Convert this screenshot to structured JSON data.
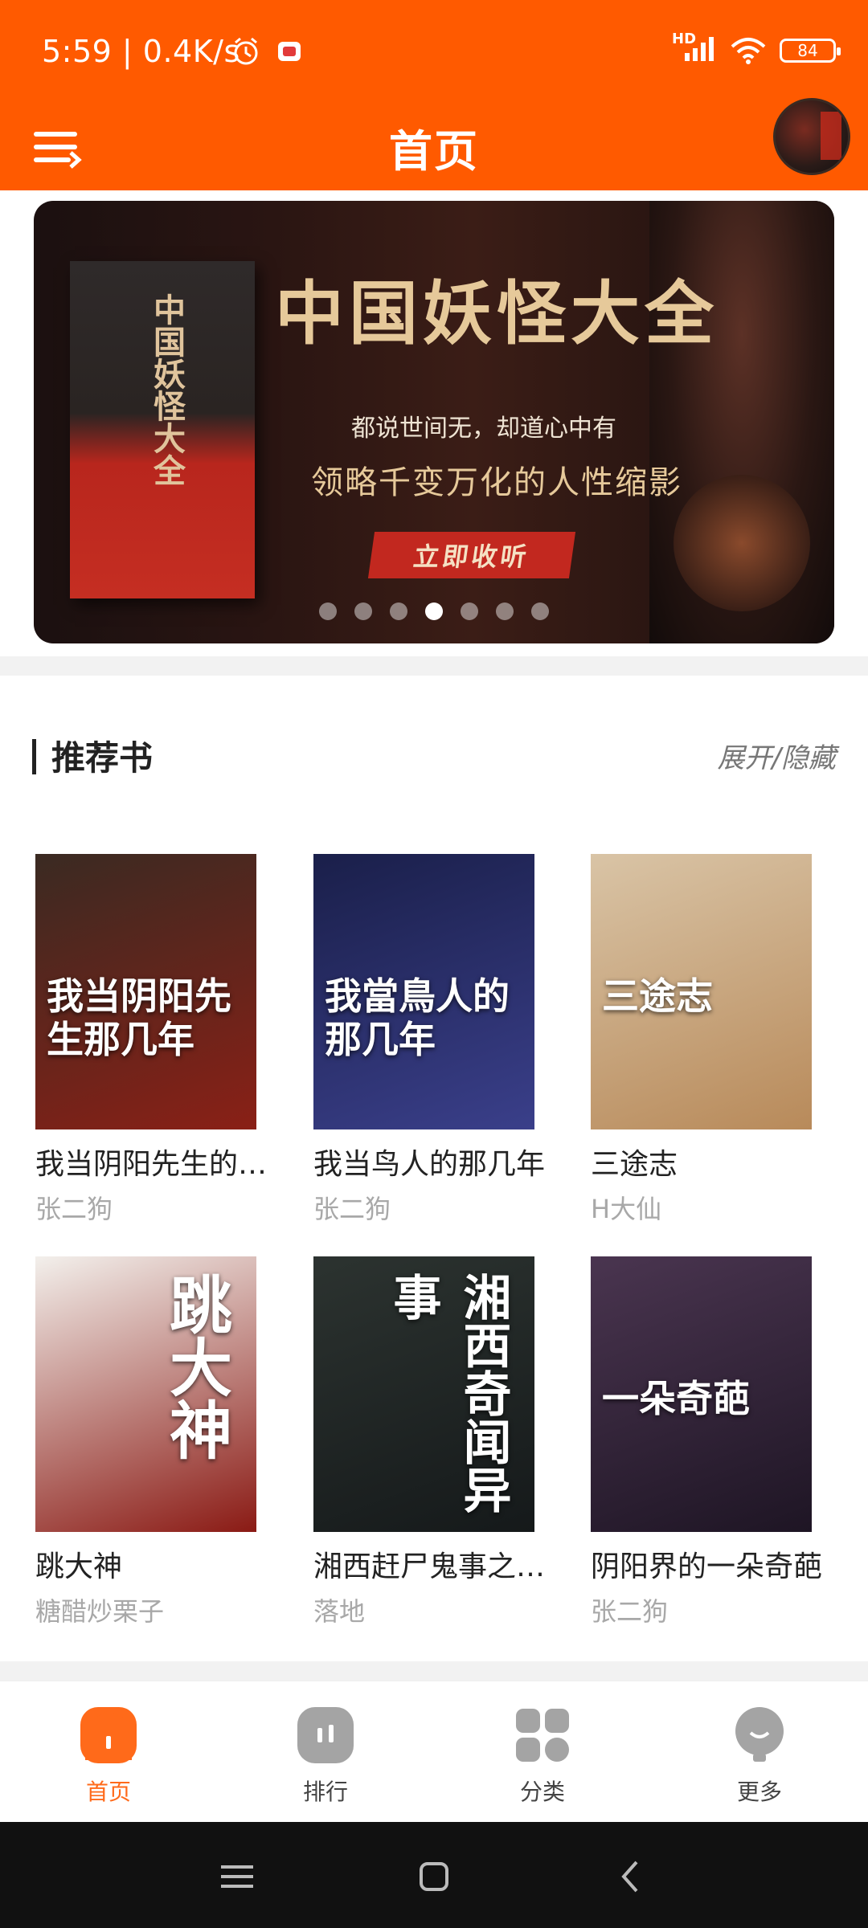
{
  "status_bar": {
    "time": "5:59 | 0.4K/s",
    "signal_label": "HD",
    "battery": "84"
  },
  "app_bar": {
    "title": "首页"
  },
  "banner": {
    "book_title": "中国妖怪大全",
    "headline": "中国妖怪大全",
    "subline1": "都说世间无，却道心中有",
    "subline2": "领略千变万化的人性缩影",
    "cta": "立即收听",
    "slide_count": 7,
    "active_slide": 4
  },
  "section": {
    "title": "推荐书",
    "toggle": "展开/隐藏"
  },
  "books": [
    {
      "title": "我当阴阳先生的…",
      "author": "张二狗",
      "cover_text": "我当阴阳先生那几年",
      "cover_colors": [
        "#3a2a22",
        "#8a2016"
      ]
    },
    {
      "title": "我当鸟人的那几年",
      "author": "张二狗",
      "cover_text": "我當鳥人的那几年",
      "cover_colors": [
        "#1a1f4a",
        "#3a3f8a"
      ]
    },
    {
      "title": "三途志",
      "author": "H大仙",
      "cover_text": "三途志",
      "cover_colors": [
        "#d9c4a6",
        "#b88a5a"
      ]
    },
    {
      "title": "跳大神",
      "author": "糖醋炒栗子",
      "cover_text": "跳大神",
      "cover_colors": [
        "#f3f0ec",
        "#8a1a14"
      ]
    },
    {
      "title": "湘西赶尸鬼事之…",
      "author": "落地",
      "cover_text": "湘西奇闻异事",
      "cover_colors": [
        "#2c3330",
        "#15191a"
      ]
    },
    {
      "title": "阴阳界的一朵奇葩",
      "author": "张二狗",
      "cover_text": "一朵奇葩",
      "cover_colors": [
        "#4a3550",
        "#1e1524"
      ]
    }
  ],
  "tabs": [
    {
      "label": "首页",
      "icon": "home-icon",
      "active": true
    },
    {
      "label": "排行",
      "icon": "ranking-icon",
      "active": false
    },
    {
      "label": "分类",
      "icon": "category-icon",
      "active": false
    },
    {
      "label": "更多",
      "icon": "more-icon",
      "active": false
    }
  ],
  "colors": {
    "brand": "#ff5a00",
    "tab_active": "#ff6a1a"
  }
}
